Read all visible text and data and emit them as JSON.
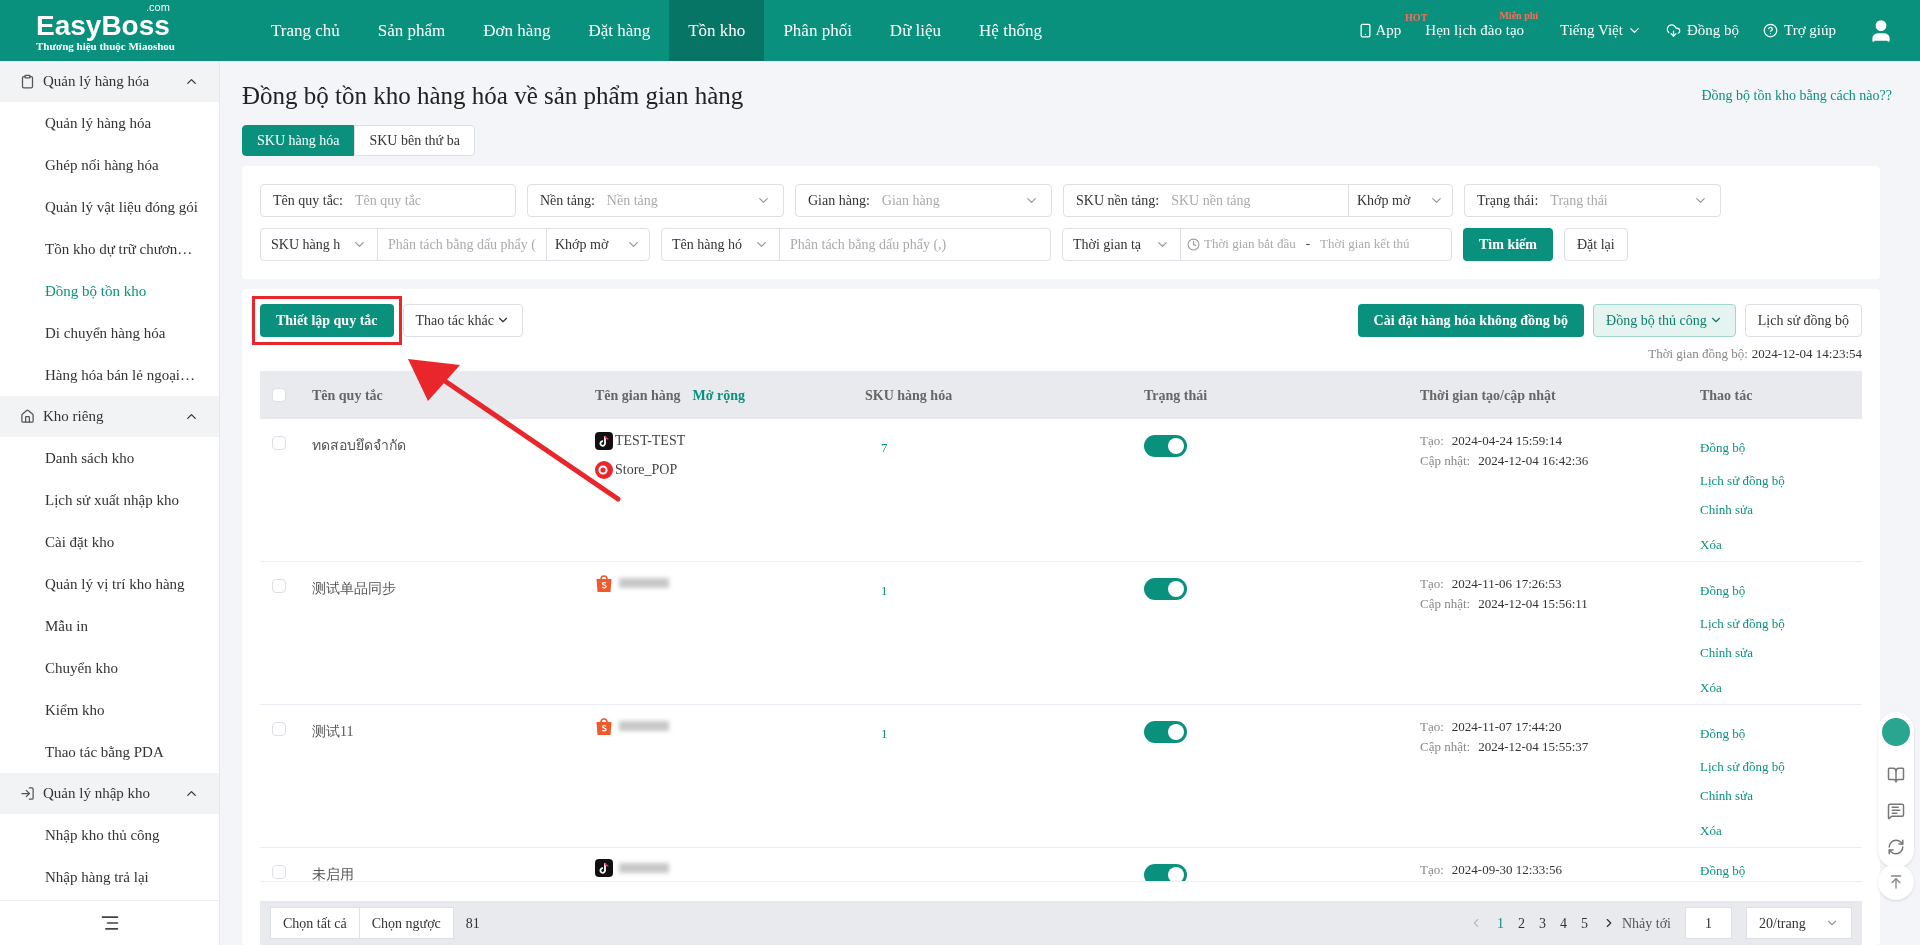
{
  "header": {
    "logo": {
      "name": "EasyBoss",
      "suffix": ".com",
      "tagline": "Thương hiệu thuộc Miaoshou"
    },
    "nav": [
      {
        "label": "Trang chủ",
        "selected": false
      },
      {
        "label": "Sản phẩm",
        "selected": false
      },
      {
        "label": "Đơn hàng",
        "selected": false
      },
      {
        "label": "Đặt hàng",
        "selected": false
      },
      {
        "label": "Tồn kho",
        "selected": true
      },
      {
        "label": "Phân phối",
        "selected": false
      },
      {
        "label": "Dữ liệu",
        "selected": false
      },
      {
        "label": "Hệ thống",
        "selected": false
      }
    ],
    "tools": [
      {
        "kind": "app",
        "label": "App",
        "badge": "HOT"
      },
      {
        "kind": "training",
        "label": "Hẹn lịch đào tạo",
        "badge": "Miễn phí"
      },
      {
        "kind": "language",
        "label": "Tiếng Việt"
      },
      {
        "kind": "sync",
        "label": "Đồng bộ"
      },
      {
        "kind": "help",
        "label": "Trợ giúp"
      },
      {
        "kind": "user"
      }
    ]
  },
  "sidebar": {
    "groups": [
      {
        "label": "Quản lý hàng hóa",
        "expanded": true,
        "items": [
          {
            "label": "Quản lý hàng hóa",
            "selected": false
          },
          {
            "label": "Ghép nối hàng hóa",
            "selected": false
          },
          {
            "label": "Quản lý vật liệu đóng gói",
            "selected": false
          },
          {
            "label": "Tồn kho dự trữ chươn…",
            "selected": false
          },
          {
            "label": "Đồng bộ tồn kho",
            "selected": true
          },
          {
            "label": "Di chuyển hàng hóa",
            "selected": false
          },
          {
            "label": "Hàng hóa bán lẻ ngoại…",
            "selected": false
          }
        ]
      },
      {
        "label": "Kho riêng",
        "expanded": true,
        "items": [
          {
            "label": "Danh sách kho",
            "selected": false
          },
          {
            "label": "Lịch sử xuất nhập kho",
            "selected": false
          },
          {
            "label": "Cài đặt kho",
            "selected": false
          },
          {
            "label": "Quản lý vị trí kho hàng",
            "selected": false
          },
          {
            "label": "Mẫu in",
            "selected": false
          },
          {
            "label": "Chuyển kho",
            "selected": false
          },
          {
            "label": "Kiểm kho",
            "selected": false
          },
          {
            "label": "Thao tác bằng PDA",
            "selected": false
          }
        ]
      },
      {
        "label": "Quản lý nhập kho",
        "expanded": true,
        "items": [
          {
            "label": "Nhập kho thủ công",
            "selected": false
          },
          {
            "label": "Nhập hàng trả lại",
            "selected": false
          }
        ]
      }
    ]
  },
  "page": {
    "title": "Đồng bộ tồn kho hàng hóa về sản phẩm gian hàng",
    "help_link": "Đồng bộ tồn kho bằng cách nào??",
    "tabs": [
      {
        "label": "SKU hàng hóa",
        "selected": true
      },
      {
        "label": "SKU bên thứ ba",
        "selected": false
      }
    ]
  },
  "filters": [
    [
      {
        "kind": "text",
        "label": "Tên quy tắc:",
        "placeholder": "Tên quy tắc"
      },
      {
        "kind": "select",
        "label": "Nền tảng:",
        "placeholder": "Nền tảng"
      },
      {
        "kind": "select",
        "label": "Gian hàng:",
        "placeholder": "Gian hàng"
      },
      {
        "kind": "text_match",
        "label": "SKU nền tảng:",
        "placeholder": "SKU nền tảng",
        "match": "Khớp mờ"
      },
      {
        "kind": "select",
        "label": "Trạng thái:",
        "placeholder": "Trạng thái"
      }
    ],
    [
      {
        "kind": "picker_input",
        "option": "SKU hàng h",
        "placeholder": "Phân tách bằng dấu phẩy (",
        "match": "Khớp mờ"
      },
      {
        "kind": "picker_input",
        "option": "Tên hàng hó",
        "placeholder": "Phân tách bằng dấu phẩy (,)"
      },
      {
        "kind": "date_range",
        "option": "Thời gian tạ",
        "start": "Thời gian bắt đầu",
        "separator": "-",
        "end": "Thời gian kết thú"
      },
      {
        "kind": "primary",
        "label": "Tìm kiếm"
      },
      {
        "kind": "outline",
        "label": "Đặt lại"
      }
    ]
  ],
  "toolbar": {
    "left": [
      {
        "kind": "primary",
        "label": "Thiết lập quy tắc",
        "highlighted": true
      },
      {
        "kind": "dropdown",
        "label": "Thao tác khác",
        "highlighted": false
      }
    ],
    "right": [
      {
        "kind": "primary",
        "label": "Cài đặt hàng hóa không đồng bộ"
      },
      {
        "kind": "soft_dropdown",
        "label": "Đồng bộ thủ công"
      },
      {
        "kind": "outline",
        "label": "Lịch sử đồng bộ"
      }
    ],
    "sync_time": {
      "label": "Thời gian đồng bộ:",
      "value": "2024-12-04 14:23:54"
    }
  },
  "table": {
    "columns": [
      "Tên quy tắc",
      "Tên gian hàng",
      "SKU hàng hóa",
      "Trạng thái",
      "Thời gian tạo/cập nhật",
      "Thao tác"
    ],
    "expand_link": "Mở rộng",
    "all_checked": false,
    "rows": [
      {
        "checked": false,
        "name": "ทดสอบยึดจำกัด",
        "stores": [
          {
            "kind": "tiktok",
            "name": "TEST-TEST"
          },
          {
            "kind": "circle",
            "name": "Store_POP"
          }
        ],
        "sku": "7",
        "on": true,
        "created_label": "Tạo:",
        "created": "2024-04-24 15:59:14",
        "updated_label": "Cập nhật:",
        "updated": "2024-12-04 16:42:36",
        "actions": [
          "Đồng bộ",
          "Lịch sử đồng bộ",
          "Chỉnh sửa",
          "Xóa"
        ]
      },
      {
        "checked": false,
        "name": "测试单品同步",
        "stores": [
          {
            "kind": "shopee"
          }
        ],
        "sku": "1",
        "on": true,
        "created_label": "Tạo:",
        "created": "2024-11-06 17:26:53",
        "updated_label": "Cập nhật:",
        "updated": "2024-12-04 15:56:11",
        "actions": [
          "Đồng bộ",
          "Lịch sử đồng bộ",
          "Chỉnh sửa",
          "Xóa"
        ]
      },
      {
        "checked": false,
        "name": "测试11",
        "stores": [
          {
            "kind": "shopee"
          }
        ],
        "sku": "1",
        "on": true,
        "created_label": "Tạo:",
        "created": "2024-11-07 17:44:20",
        "updated_label": "Cập nhật:",
        "updated": "2024-12-04 15:55:37",
        "actions": [
          "Đồng bộ",
          "Lịch sử đồng bộ",
          "Chỉnh sửa",
          "Xóa"
        ]
      },
      {
        "checked": false,
        "name": "未启用",
        "stores": [
          {
            "kind": "tiktok"
          }
        ],
        "on": true,
        "created_label": "Tạo:",
        "created": "2024-09-30 12:33:56",
        "actions": [
          "Đồng bộ"
        ]
      }
    ]
  },
  "footer": {
    "select_all": "Chọn tất cả",
    "invert": "Chọn ngược",
    "count": "81",
    "pages": [
      {
        "label": "1",
        "selected": true
      },
      {
        "label": "2",
        "selected": false
      },
      {
        "label": "3",
        "selected": false
      },
      {
        "label": "4",
        "selected": false
      },
      {
        "label": "5",
        "selected": false
      }
    ],
    "jump_label": "Nhảy tới",
    "jump_value": "1",
    "page_size": "20/trang"
  }
}
